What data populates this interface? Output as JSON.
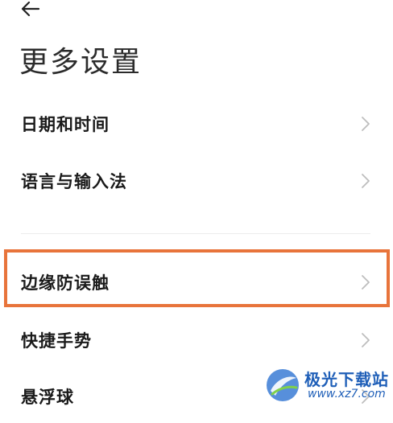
{
  "header": {
    "back_icon": "back-arrow-icon",
    "title": "更多设置"
  },
  "items": [
    {
      "label": "日期和时间",
      "icon": "chevron-right-icon"
    },
    {
      "label": "语言与输入法",
      "icon": "chevron-right-icon"
    },
    {
      "label": "边缘防误触",
      "icon": "chevron-right-icon",
      "highlighted": true
    },
    {
      "label": "快捷手势",
      "icon": "chevron-right-icon"
    },
    {
      "label": "悬浮球",
      "icon": "chevron-right-icon"
    }
  ],
  "highlight_color": "#e8743b",
  "watermark": {
    "title": "极光下载站",
    "url": "www.xz7.com",
    "color": "#1f5fb8"
  }
}
